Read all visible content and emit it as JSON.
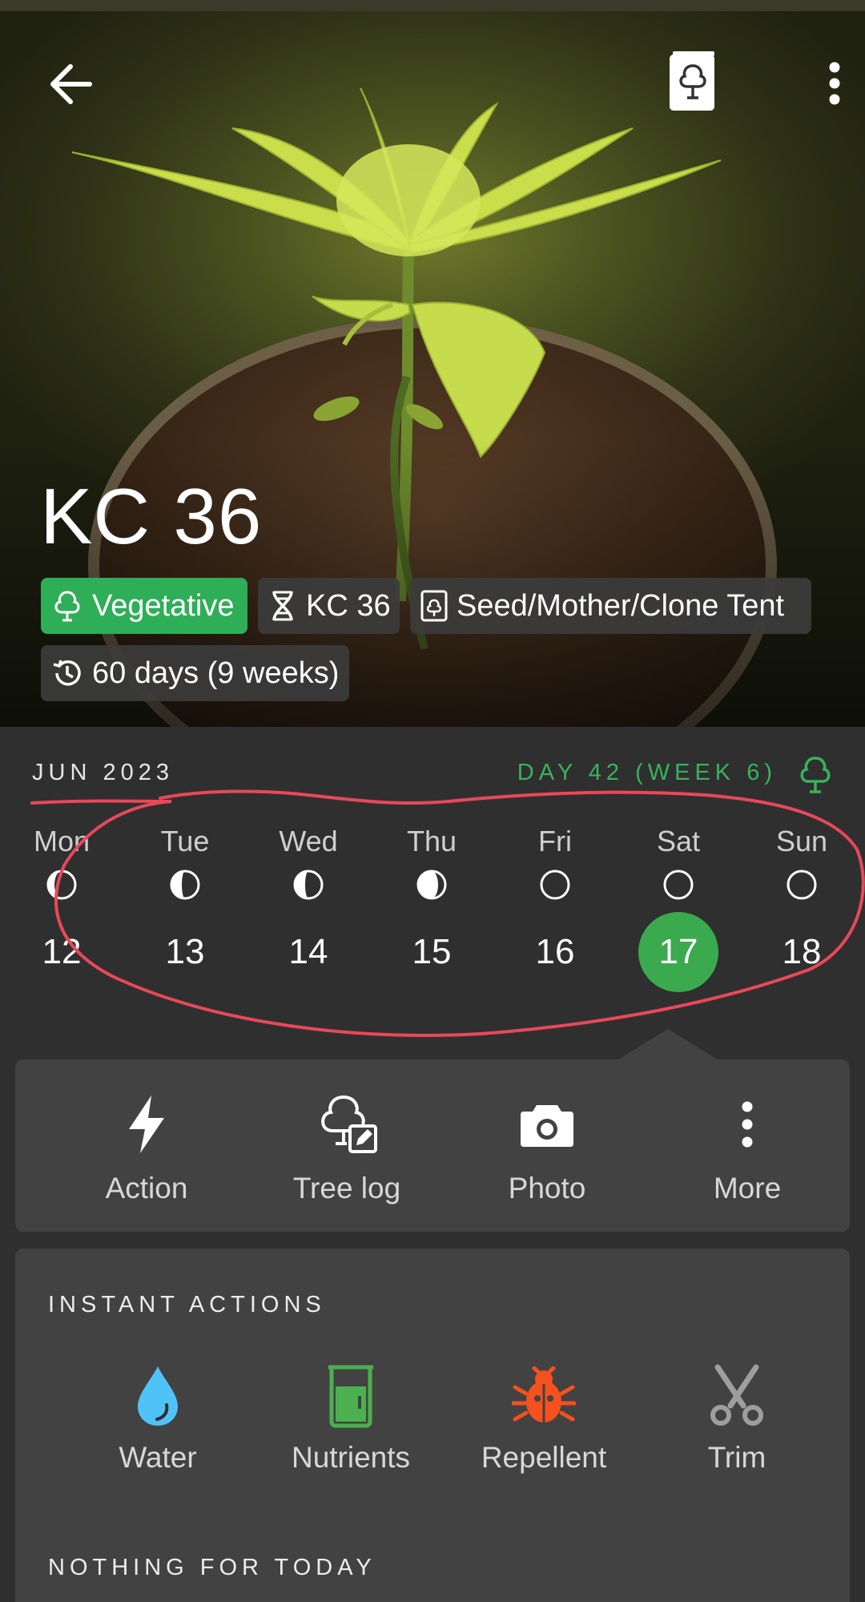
{
  "plant": {
    "name": "KC 36",
    "stage": "Vegetative",
    "strain": "KC 36",
    "location": "Seed/Mother/Clone Tent",
    "age": "60 days (9 weeks)"
  },
  "calendar": {
    "month": "JUN 2023",
    "day_label": "DAY 42 (WEEK 6)",
    "days": [
      {
        "name": "Mon",
        "num": "12",
        "moon": "waxing-gibbous"
      },
      {
        "name": "Tue",
        "num": "13",
        "moon": "last-quarter"
      },
      {
        "name": "Wed",
        "num": "14",
        "moon": "last-quarter"
      },
      {
        "name": "Thu",
        "num": "15",
        "moon": "waning-crescent"
      },
      {
        "name": "Fri",
        "num": "16",
        "moon": "new"
      },
      {
        "name": "Sat",
        "num": "17",
        "moon": "new",
        "selected": true
      },
      {
        "name": "Sun",
        "num": "18",
        "moon": "new"
      }
    ]
  },
  "actions": {
    "action_label": "Action",
    "treelog_label": "Tree log",
    "photo_label": "Photo",
    "more_label": "More"
  },
  "instant": {
    "title": "INSTANT ACTIONS",
    "water_label": "Water",
    "nutrients_label": "Nutrients",
    "repellent_label": "Repellent",
    "trim_label": "Trim",
    "empty_text": "NOTHING FOR TODAY"
  },
  "colors": {
    "accent_green": "#37b35d",
    "water_blue": "#4fc3f7",
    "nutrients_green": "#4caf50",
    "repellent_orange": "#f4511e",
    "annotation_red": "#e8485a"
  }
}
